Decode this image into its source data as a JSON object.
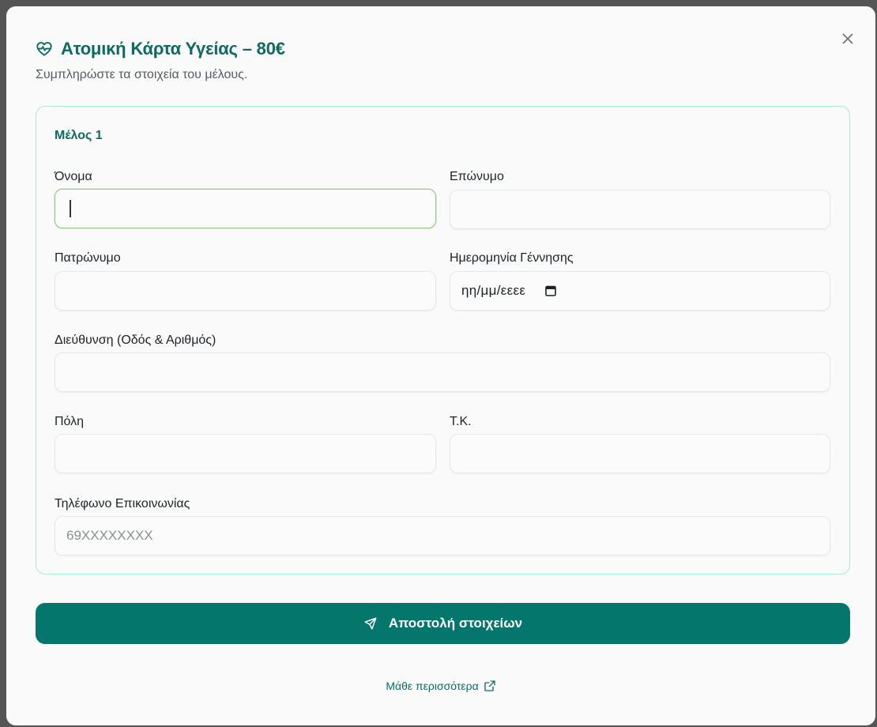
{
  "dialog": {
    "title": "Ατομική Κάρτα Υγείας – 80€",
    "subtitle": "Συμπληρώστε τα στοιχεία του μέλους.",
    "close_icon": "close-icon",
    "title_icon": "heart-pulse-icon"
  },
  "member": {
    "title": "Μέλος 1",
    "fields": {
      "first_name": {
        "label": "Όνομα",
        "value": "",
        "placeholder": ""
      },
      "last_name": {
        "label": "Επώνυμο",
        "value": "",
        "placeholder": ""
      },
      "father_name": {
        "label": "Πατρώνυμο",
        "value": "",
        "placeholder": ""
      },
      "birth_date": {
        "label": "Ημερομηνία Γέννησης",
        "placeholder": "ηη/μμ/εεεε",
        "icon": "calendar-icon"
      },
      "address": {
        "label": "Διεύθυνση (Οδός & Αριθμός)",
        "value": "",
        "placeholder": ""
      },
      "city": {
        "label": "Πόλη",
        "value": "",
        "placeholder": ""
      },
      "postal_code": {
        "label": "Τ.Κ.",
        "value": "",
        "placeholder": ""
      },
      "phone": {
        "label": "Τηλέφωνο Επικοινωνίας",
        "value": "",
        "placeholder": "69XXXXXXXX"
      }
    }
  },
  "actions": {
    "submit_label": "Αποστολή στοιχείων",
    "submit_icon": "send-icon",
    "learn_more_label": "Μάθε περισσότερα",
    "learn_more_icon": "external-link-icon"
  },
  "colors": {
    "accent": "#04766b",
    "title": "#0c6b60",
    "card_border": "#a9e8dd",
    "focus_border": "#9bc98a"
  }
}
